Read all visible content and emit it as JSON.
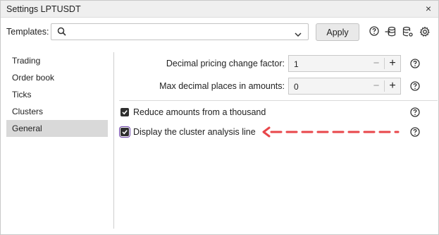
{
  "window": {
    "title": "Settings LPTUSDT",
    "close_glyph": "×"
  },
  "templates": {
    "label": "Templates:",
    "value": "",
    "placeholder": "",
    "apply_label": "Apply"
  },
  "toolbar_icons": [
    "help-icon",
    "database-import-icon",
    "database-settings-icon",
    "gear-icon"
  ],
  "sidebar": {
    "items": [
      {
        "label": "Trading",
        "active": false
      },
      {
        "label": "Order book",
        "active": false
      },
      {
        "label": "Ticks",
        "active": false
      },
      {
        "label": "Clusters",
        "active": false
      },
      {
        "label": "General",
        "active": true
      }
    ]
  },
  "fields": {
    "pricing_factor": {
      "label": "Decimal pricing change factor:",
      "value": "1",
      "minus": "−",
      "plus": "+"
    },
    "max_decimals": {
      "label": "Max decimal places in amounts:",
      "value": "0",
      "minus": "−",
      "plus": "+"
    }
  },
  "checks": {
    "reduce": {
      "label": "Reduce amounts from a thousand",
      "checked": true
    },
    "cluster_line": {
      "label": "Display the cluster analysis line",
      "checked": true
    }
  },
  "colors": {
    "annotation_arrow": "#e8464a",
    "checkbox_fill": "#2f2f2f",
    "focus_outline": "#6a3fa6"
  }
}
